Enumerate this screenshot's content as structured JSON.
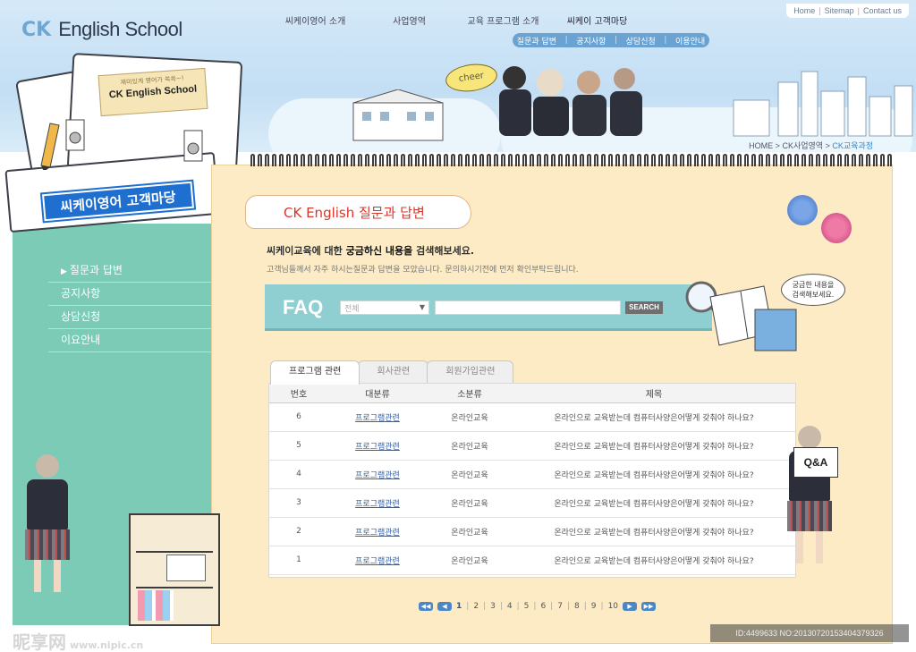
{
  "logo": {
    "prefix": "CK",
    "name": "English School"
  },
  "util_links": [
    "Home",
    "Sitemap",
    "Contact us"
  ],
  "gnb": [
    "씨케이영어 소개",
    "사업영역",
    "교육 프로그램 소개",
    "씨케이 고객마당"
  ],
  "subnav": [
    "질문과 답변",
    "공지사항",
    "상담신청",
    "이용안내"
  ],
  "breadcrumb": {
    "home": "HOME",
    "mid": "CK사업영역",
    "current": "CK교육과정",
    "sep": ">"
  },
  "book": {
    "sign_small": "재미있게 영어가 쏙쏙~!",
    "sign_big": "CK English School",
    "title": "씨케이영어 고객마당"
  },
  "lnb": [
    {
      "label": "질문과 답변",
      "active": true
    },
    {
      "label": "공지사항",
      "active": false
    },
    {
      "label": "상담신청",
      "active": false
    },
    {
      "label": "이요안내",
      "active": false
    }
  ],
  "title": "CK English 질문과 답변",
  "intro": {
    "headline_pre": "씨케이교육에 대한 ",
    "headline_em": "궁금하신 내용을",
    "headline_post": " 검색해보세요.",
    "sub": "고객님들께서 자주 하시는질문과 답변을 모았습니다. 문의하시기전에 먼저 확인부탁드립니다."
  },
  "faq": {
    "label": "FAQ",
    "select_value": "전체",
    "search_value": "",
    "button": "SEARCH",
    "bubble_line1": "궁금한 내용을",
    "bubble_line2": "검색해보세요."
  },
  "tabs": [
    {
      "label": "프로그램 관련",
      "active": true
    },
    {
      "label": "회사관련",
      "active": false
    },
    {
      "label": "회원가입관련",
      "active": false
    }
  ],
  "table": {
    "headers": [
      "번호",
      "대분류",
      "소분류",
      "제목"
    ],
    "rows": [
      {
        "no": "6",
        "cat1": "프로그램관련",
        "cat2": "온라인교육",
        "title": "온라인으로 교육받는데 컴퓨터사양은어떻게 갖춰야 하나요?"
      },
      {
        "no": "5",
        "cat1": "프로그램관련",
        "cat2": "온라인교육",
        "title": "온라인으로 교육받는데 컴퓨터사양은어떻게 갖춰야 하나요?"
      },
      {
        "no": "4",
        "cat1": "프로그램관련",
        "cat2": "온라인교육",
        "title": "온라인으로 교육받는데 컴퓨터사양은어떻게 갖춰야 하나요?"
      },
      {
        "no": "3",
        "cat1": "프로그램관련",
        "cat2": "온라인교육",
        "title": "온라인으로 교육받는데 컴퓨터사양은어떻게 갖춰야 하나요?"
      },
      {
        "no": "2",
        "cat1": "프로그램관련",
        "cat2": "온라인교육",
        "title": "온라인으로 교육받는데 컴퓨터사양은어떻게 갖춰야 하나요?"
      },
      {
        "no": "1",
        "cat1": "프로그램관련",
        "cat2": "온라인교육",
        "title": "온라인으로 교육받는데 컴퓨터사양은어떻게 갖춰야 하나요?"
      }
    ]
  },
  "pager": {
    "pages": [
      "1",
      "2",
      "3",
      "4",
      "5",
      "6",
      "7",
      "8",
      "9",
      "10"
    ],
    "current": "1"
  },
  "decor": {
    "cheer": "cheer",
    "qa": "Q&A"
  },
  "watermark": {
    "brand": "昵享网",
    "url": "www.nipic.cn",
    "id": "ID:4499633 NO:20130720153404379326"
  },
  "colors": {
    "accent_blue": "#1f6fd0",
    "teal": "#7bcbb7",
    "paper": "#fcebc4",
    "faq_band": "#90cfd1",
    "title_red": "#d6372b"
  }
}
